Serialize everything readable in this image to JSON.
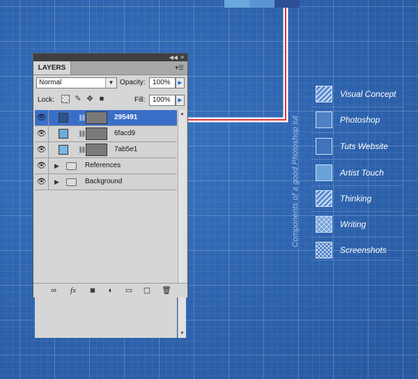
{
  "panel": {
    "tab_label": "LAYERS",
    "blend_mode": "Normal",
    "opacity_label": "Opacity:",
    "opacity_value": "100%",
    "lock_label": "Lock:",
    "fill_label": "Fill:",
    "fill_value": "100%",
    "layers": [
      {
        "name": "295491",
        "color": "#295491",
        "selected": true
      },
      {
        "name": "6facd9",
        "color": "#6facd9",
        "selected": false
      },
      {
        "name": "7ab5e1",
        "color": "#7ab5e1",
        "selected": false
      }
    ],
    "groups": [
      {
        "name": "References"
      },
      {
        "name": "Background"
      }
    ]
  },
  "canvas": {
    "vertical_label": "Components of a good Photoshop tut",
    "top_swatches": [
      "#6aa7dc",
      "#5b96d2",
      "#2d4f95"
    ],
    "connector_color": "#e0333a",
    "legend": [
      {
        "label": "Visual Concept",
        "fill": "hatch"
      },
      {
        "label": "Photoshop",
        "fill": "#4f82c4"
      },
      {
        "label": "Tuts Website",
        "fill": "#3f73bb"
      },
      {
        "label": "Artist Touch",
        "fill": "#6aa3da"
      },
      {
        "label": "Thinking",
        "fill": "hatch"
      },
      {
        "label": "Writing",
        "fill": "crosshatch-light"
      },
      {
        "label": "Screenshots",
        "fill": "crosshatch"
      }
    ]
  }
}
